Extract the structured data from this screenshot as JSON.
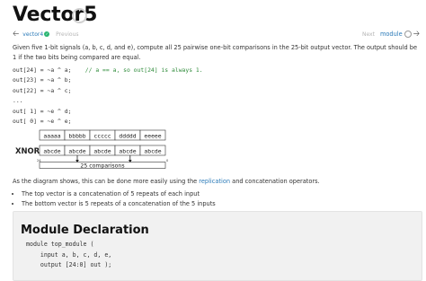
{
  "page": {
    "title": "Vector5"
  },
  "nav": {
    "prev_problem": "vector4",
    "prev_label": "Previous",
    "next_label": "Next",
    "module_label": "module"
  },
  "prompt": "Given five 1-bit signals (a, b, c, d, and e), compute all 25 pairwise one-bit comparisons in the 25-bit output vector. The output should be 1 if the two bits being compared are equal.",
  "code_example": {
    "lines": [
      {
        "code": "out[24] = ~a ^ a;",
        "comment": "// a == a, so out[24] is always 1."
      },
      {
        "code": "out[23] = ~a ^ b;",
        "comment": ""
      },
      {
        "code": "out[22] = ~a ^ c;",
        "comment": ""
      },
      {
        "code": "...",
        "comment": ""
      },
      {
        "code": "out[ 1] = ~e ^ d;",
        "comment": ""
      },
      {
        "code": "out[ 0] = ~e ^ e;",
        "comment": ""
      }
    ]
  },
  "diagram": {
    "top_cells": [
      "aaaaa",
      "bbbbb",
      "ccccc",
      "ddddd",
      "eeeee"
    ],
    "operator": "XNOR",
    "bottom_cells": [
      "abcde",
      "abcde",
      "abcde",
      "abcde",
      "abcde"
    ],
    "msb_label": "24",
    "lsb_label": "0",
    "caption": "25 comparisons"
  },
  "explanation": {
    "before": "As the diagram shows, this can be done more easily using the ",
    "link": "replication",
    "after": " and concatenation operators."
  },
  "bullets": [
    "The top vector is a concatenation of 5 repeats of each input",
    "The bottom vector is 5 repeats of a concatenation of the 5 inputs"
  ],
  "module_section": {
    "title": "Module Declaration",
    "code_lines": [
      "module top_module (",
      "    input a, b, c, d, e,",
      "    output [24:0] out );"
    ]
  },
  "colors": {
    "link": "#2a7ab8",
    "completed_check": "#2bb673",
    "panel_bg": "#f1f1f1"
  }
}
